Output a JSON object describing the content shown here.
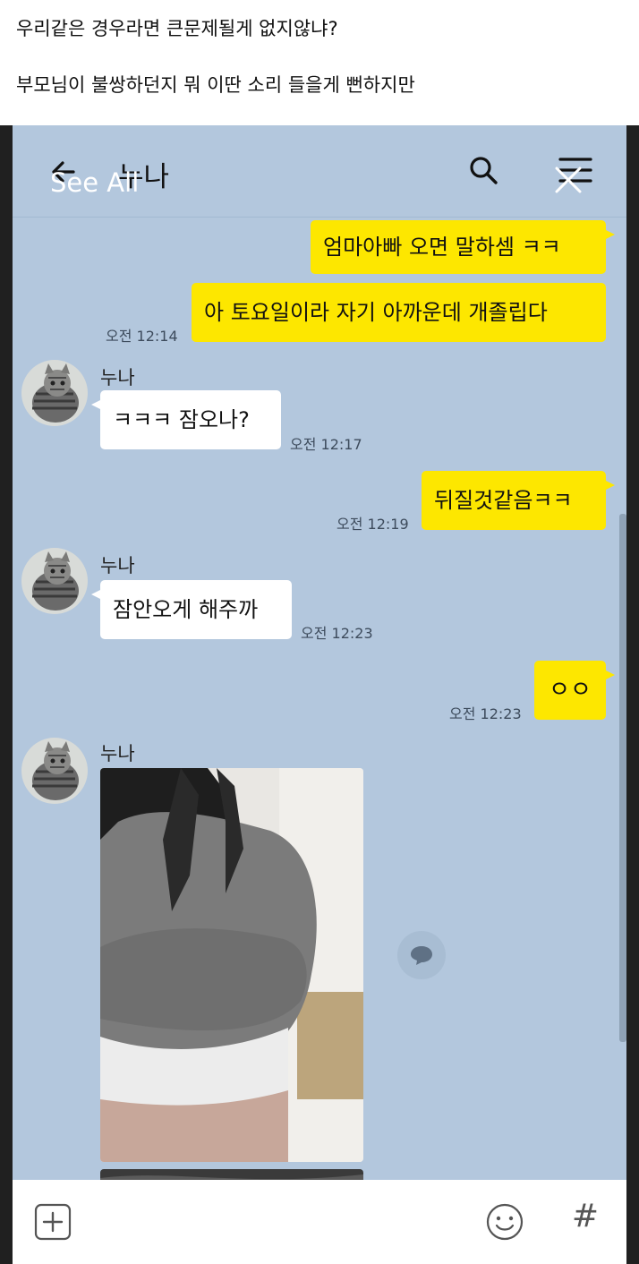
{
  "post": {
    "line1": "우리같은 경우라면 큰문제될게 없지않냐?",
    "line2": "부모님이 불쌍하던지 뭐 이딴 소리 들을게 뻔하지만"
  },
  "overlay": {
    "see_all": "See All"
  },
  "chat_header": {
    "title": "누나",
    "icons": {
      "back": "back-arrow-icon",
      "search": "search-icon",
      "menu": "menu-icon",
      "close": "close-icon"
    }
  },
  "messages": [
    {
      "side": "me",
      "text": "엄마아빠 오면 말하셈 ㅋㅋ",
      "time": ""
    },
    {
      "side": "me",
      "text": "아 토요일이라 자기 아까운데 개졸립다",
      "time": "오전 12:14"
    },
    {
      "side": "you",
      "sender": "누나",
      "text": "ㅋㅋㅋ 잠오나?",
      "time": "오전 12:17"
    },
    {
      "side": "me",
      "text": "뒤질것같음ㅋㅋ",
      "time": "오전 12:19"
    },
    {
      "side": "you",
      "sender": "누나",
      "text": "잠안오게 해주까",
      "time": "오전 12:23"
    },
    {
      "side": "me",
      "text": "ㅇㅇ",
      "time": "오전 12:23"
    },
    {
      "side": "you",
      "sender": "누나",
      "type": "photo",
      "time": ""
    }
  ],
  "input_bar": {
    "icons": {
      "attach": "plus-icon",
      "emoji": "emoji-icon",
      "hashtag": "hashtag-icon"
    },
    "hash_symbol": "#"
  },
  "colors": {
    "chat_background": "#b3c7dd",
    "my_bubble": "#fde700",
    "their_bubble": "#ffffff"
  }
}
